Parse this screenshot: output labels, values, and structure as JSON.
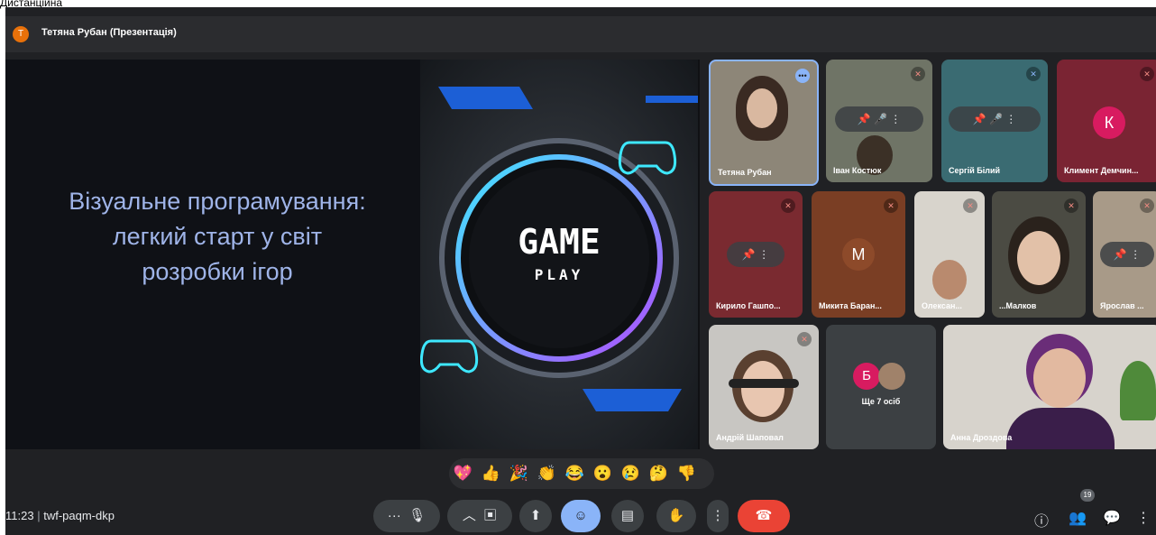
{
  "top_fragment": "Дистанційна",
  "header": {
    "presenter_avatar_letter": "Т",
    "title": "Тетяна Рубан (Презентація)"
  },
  "slide": {
    "title_line1": "Візуальне програмування:",
    "title_line2": "легкий старт у світ",
    "title_line3": "розробки ігор",
    "logo_text1": "GAME",
    "logo_text2": "PLAY"
  },
  "participants": [
    {
      "name": "Тетяна Рубан"
    },
    {
      "name": "Іван Костюк"
    },
    {
      "name": "Сергій Білий"
    },
    {
      "name": "Климент Демчин...",
      "letter": "К"
    },
    {
      "name": "Кирило Гашпо..."
    },
    {
      "name": "Микита Баран...",
      "letter": "M"
    },
    {
      "name": "Олексан..."
    },
    {
      "name": "...Малков"
    },
    {
      "name": "Ярослав ..."
    },
    {
      "name": "Андрій Шаповал"
    },
    {
      "name": "Анна Дроздова"
    }
  ],
  "others": {
    "letter": "Б",
    "label": "Ще 7 осіб"
  },
  "reactions": [
    "💖",
    "👍",
    "🎉",
    "👏",
    "😂",
    "😮",
    "😢",
    "🤔",
    "👎"
  ],
  "meeting": {
    "time": "11:23",
    "code": "twf-paqm-dkp"
  },
  "participants_count": "19",
  "icons": {
    "mic": "mic-icon",
    "camera": "camera-icon",
    "present": "present-icon",
    "emoji": "emoji-icon",
    "captions": "captions-icon",
    "hand": "raise-hand-icon",
    "more": "more-options-icon",
    "end": "end-call-icon",
    "info": "info-icon",
    "people": "people-icon",
    "chat": "chat-icon",
    "activities": "activities-icon"
  },
  "colors": {
    "end_call": "#ea4335",
    "active_button": "#8ab4f8",
    "presenter_avatar": "#e8710a"
  }
}
